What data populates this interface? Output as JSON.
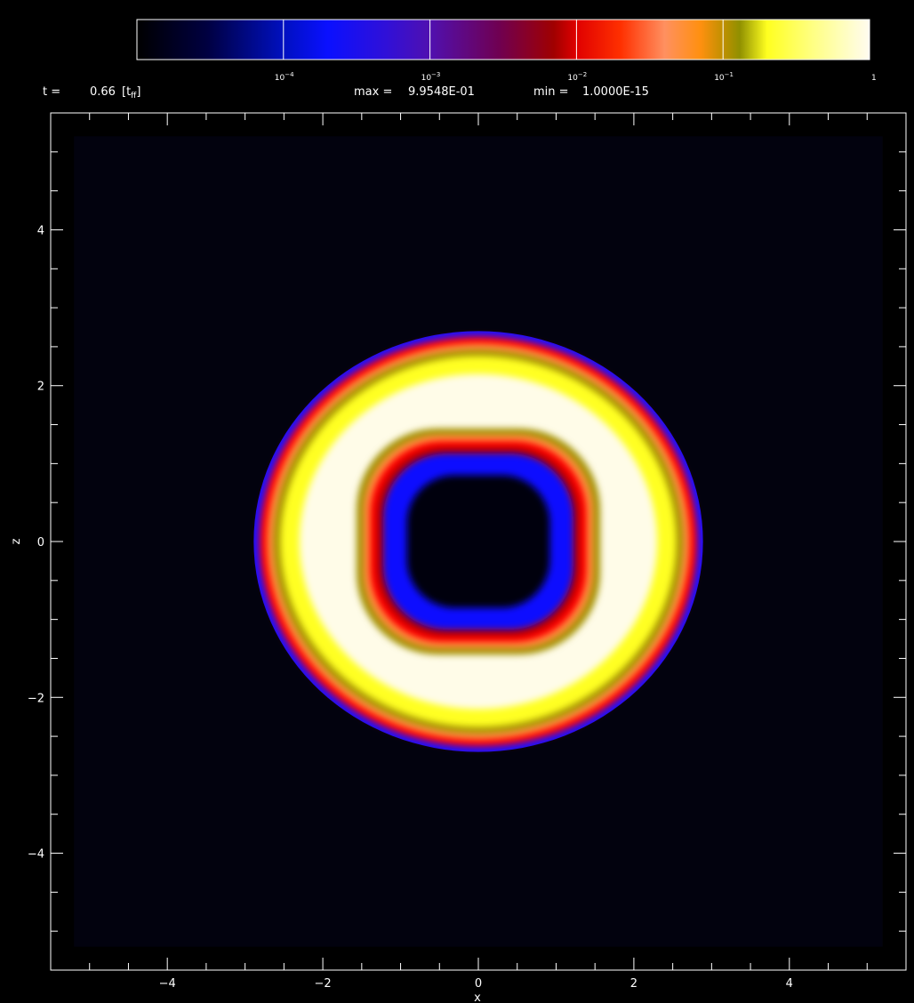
{
  "header": {
    "time_label": "t =",
    "time_value": "0.66",
    "time_unit_main": "[t",
    "time_unit_sub": "ff",
    "time_unit_close": "]",
    "max_label": "max =",
    "max_value": "9.9548E-01",
    "min_label": "min =",
    "min_value": "1.0000E-15"
  },
  "colorbar": {
    "scale": "log",
    "range": [
      1e-05,
      1
    ],
    "stops": [
      {
        "v": 1e-05,
        "color": "#000000"
      },
      {
        "v": 3e-05,
        "color": "#000040"
      },
      {
        "v": 0.0001,
        "color": "#0010c0"
      },
      {
        "v": 0.0002,
        "color": "#0a10ff"
      },
      {
        "v": 0.0005,
        "color": "#3010d8"
      },
      {
        "v": 0.001,
        "color": "#5010b0"
      },
      {
        "v": 0.003,
        "color": "#700050"
      },
      {
        "v": 0.007,
        "color": "#a00000"
      },
      {
        "v": 0.01,
        "color": "#e00000"
      },
      {
        "v": 0.02,
        "color": "#ff3000"
      },
      {
        "v": 0.04,
        "color": "#ff9060"
      },
      {
        "v": 0.07,
        "color": "#ff9010"
      },
      {
        "v": 0.1,
        "color": "#c09000"
      },
      {
        "v": 0.13,
        "color": "#909000"
      },
      {
        "v": 0.2,
        "color": "#ffff20"
      },
      {
        "v": 0.4,
        "color": "#ffff80"
      },
      {
        "v": 1,
        "color": "#fffcf0"
      }
    ],
    "ticks": [
      {
        "v": 0.0001,
        "base": "10",
        "exp": "−4",
        "separator": true
      },
      {
        "v": 0.001,
        "base": "10",
        "exp": "−3",
        "separator": true
      },
      {
        "v": 0.01,
        "base": "10",
        "exp": "−2",
        "separator": true
      },
      {
        "v": 0.1,
        "base": "10",
        "exp": "−1",
        "separator": true
      },
      {
        "v": 1,
        "label": "1",
        "separator": false
      }
    ]
  },
  "chart_data": {
    "type": "heatmap",
    "title": "",
    "xlabel": "x",
    "ylabel": "z",
    "xlim": [
      -5.5,
      5.5
    ],
    "ylim": [
      -5.5,
      5.5
    ],
    "data_extent": [
      -5.2,
      5.2
    ],
    "x_ticks": [
      {
        "v": -4,
        "label": "−4"
      },
      {
        "v": -2,
        "label": "−2"
      },
      {
        "v": 0,
        "label": "0"
      },
      {
        "v": 2,
        "label": "2"
      },
      {
        "v": 4,
        "label": "4"
      }
    ],
    "y_ticks": [
      {
        "v": 4,
        "label": "4"
      },
      {
        "v": 2,
        "label": "2"
      },
      {
        "v": 0,
        "label": "0"
      },
      {
        "v": -2,
        "label": "−2"
      },
      {
        "v": -4,
        "label": "−4"
      }
    ],
    "minor_tick_step": 0.5,
    "background_value": 1e-15,
    "background_color": "#02020e",
    "structure": {
      "shape": "ring",
      "outer_boundary_radius": 2.7,
      "inner_boundary_half_width": 1.45,
      "bands": [
        {
          "boundary": "outer",
          "offset": 0.0,
          "color": "#1a10ff"
        },
        {
          "boundary": "outer",
          "offset": 0.07,
          "color": "#ff0000"
        },
        {
          "boundary": "outer",
          "offset": 0.16,
          "color": "#ff9040"
        },
        {
          "boundary": "outer",
          "offset": 0.24,
          "color": "#a09000"
        },
        {
          "boundary": "outer",
          "offset": 0.32,
          "color": "#ffff20"
        },
        {
          "boundary": "outer",
          "offset": 0.55,
          "color": "#fffce8"
        },
        {
          "boundary": "inner",
          "offset": 0.0,
          "color": "#a09000"
        },
        {
          "boundary": "inner",
          "offset": 0.08,
          "color": "#ff9040"
        },
        {
          "boundary": "inner",
          "offset": 0.16,
          "color": "#ff0000"
        },
        {
          "boundary": "inner",
          "offset": 0.24,
          "color": "#b00000"
        },
        {
          "boundary": "inner",
          "offset": 0.32,
          "color": "#1010ff"
        },
        {
          "boundary": "inner",
          "offset": 0.6,
          "color": "#000008"
        }
      ]
    }
  }
}
